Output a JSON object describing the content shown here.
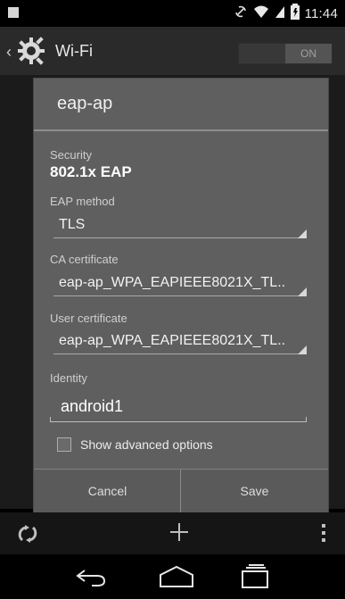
{
  "status_bar": {
    "time": "11:44",
    "icons": [
      "rotate-lock-icon",
      "wifi-icon",
      "cell-signal-icon",
      "battery-icon",
      "notification-square-icon"
    ]
  },
  "action_bar": {
    "title": "Wi-Fi",
    "toggle_label": "ON"
  },
  "dialog": {
    "title": "eap-ap",
    "security_label": "Security",
    "security_value": "802.1x EAP",
    "eap_method_label": "EAP method",
    "eap_method_value": "TLS",
    "ca_cert_label": "CA certificate",
    "ca_cert_value": "eap-ap_WPA_EAPIEEE8021X_TL..",
    "user_cert_label": "User certificate",
    "user_cert_value": "eap-ap_WPA_EAPIEEE8021X_TL..",
    "identity_label": "Identity",
    "identity_value": "android1",
    "advanced_label": "Show advanced options",
    "cancel_label": "Cancel",
    "save_label": "Save"
  },
  "colors": {
    "dialog_bg": "#5f5f5f",
    "action_bar_bg": "#2a2a2a",
    "toolbar_bg": "#151515"
  }
}
